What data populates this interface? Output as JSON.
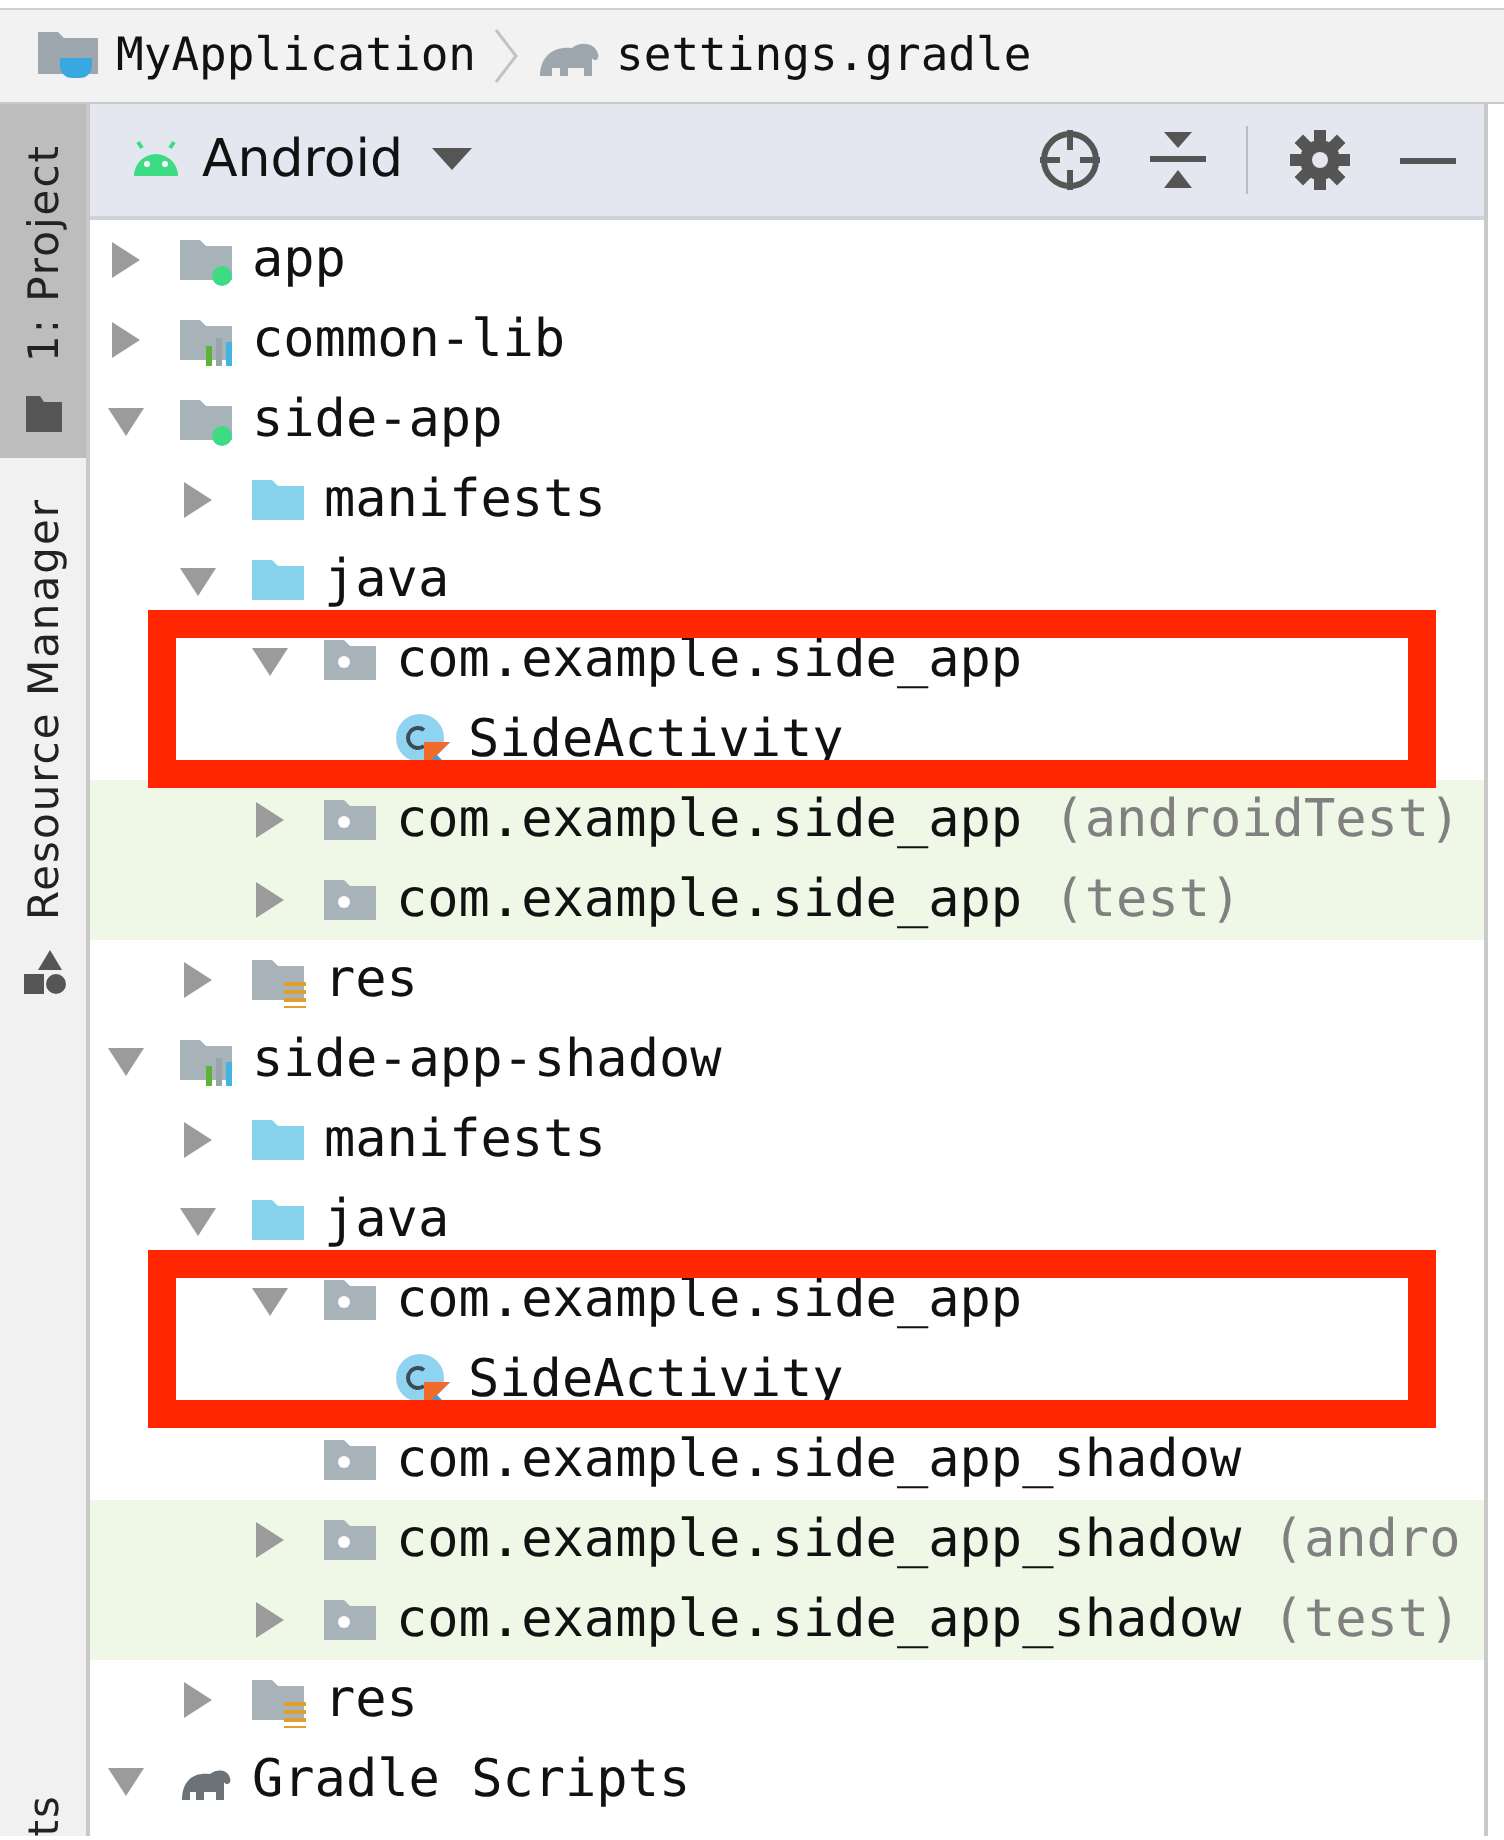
{
  "breadcrumb": [
    {
      "label": "MyApplication",
      "kind": "project"
    },
    {
      "label": "settings.gradle",
      "kind": "gradle"
    }
  ],
  "side_tabs": [
    {
      "label": "1: Project",
      "kind": "project",
      "selected": true
    },
    {
      "label": "Resource Manager",
      "kind": "resources",
      "selected": false
    },
    {
      "label": "ts",
      "kind": "none",
      "selected": false
    }
  ],
  "toolbar": {
    "view": "Android"
  },
  "tree": [
    {
      "label": "app",
      "kind": "module",
      "expanded": false
    },
    {
      "label": "common-lib",
      "kind": "library",
      "expanded": false
    },
    {
      "label": "side-app",
      "kind": "module",
      "expanded": true,
      "children": [
        {
          "label": "manifests",
          "kind": "folder",
          "expanded": false
        },
        {
          "label": "java",
          "kind": "folder",
          "expanded": true,
          "children": [
            {
              "label": "com.example.side_app",
              "kind": "package",
              "expanded": true,
              "highlighted": true,
              "children": [
                {
                  "label": "SideActivity",
                  "kind": "class"
                }
              ]
            },
            {
              "label": "com.example.side_app",
              "suffix": "(androidTest)",
              "kind": "test-package",
              "expanded": false,
              "highlighted": false
            },
            {
              "label": "com.example.side_app",
              "suffix": "(test)",
              "kind": "test-package",
              "expanded": false,
              "highlighted": false
            }
          ]
        },
        {
          "label": "res",
          "kind": "res",
          "expanded": false
        }
      ]
    },
    {
      "label": "side-app-shadow",
      "kind": "library",
      "expanded": true,
      "children": [
        {
          "label": "manifests",
          "kind": "folder",
          "expanded": false
        },
        {
          "label": "java",
          "kind": "folder",
          "expanded": true,
          "children": [
            {
              "label": "com.example.side_app",
              "kind": "package",
              "expanded": true,
              "highlighted": true,
              "children": [
                {
                  "label": "SideActivity",
                  "kind": "class"
                }
              ]
            },
            {
              "label": "com.example.side_app_shadow",
              "kind": "package",
              "highlighted": false
            },
            {
              "label": "com.example.side_app_shadow",
              "suffix": "(andro",
              "kind": "test-package",
              "expanded": false,
              "highlighted": false
            },
            {
              "label": "com.example.side_app_shadow",
              "suffix": "(test)",
              "kind": "test-package",
              "expanded": false,
              "highlighted": false
            }
          ]
        },
        {
          "label": "res",
          "kind": "res",
          "expanded": false
        }
      ]
    },
    {
      "label": "Gradle Scripts",
      "kind": "gradle",
      "expanded": true
    }
  ]
}
